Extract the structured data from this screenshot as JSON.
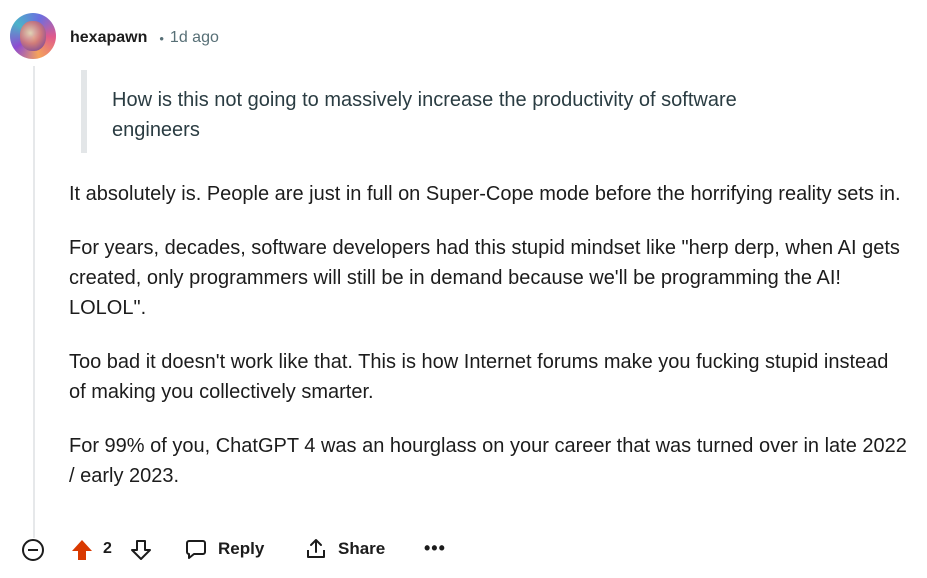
{
  "comment": {
    "username": "hexapawn",
    "separator": "•",
    "time_ago": "1d ago",
    "quote": "How is this not going to massively increase the productivity of software engineers",
    "paragraphs": [
      "It absolutely is. People are just in full on Super-Cope mode before the horrifying reality sets in.",
      "For years, decades, software developers had this stupid mindset like \"herp derp, when AI gets created, only programmers will still be in demand because we'll be programming the AI! LOLOL\".",
      "Too bad it doesn't work like that. This is how Internet forums make you fucking stupid instead of making you collectively smarter.",
      "For 99% of you, ChatGPT 4 was an hourglass on your career that was turned over in late 2022 / early 2023."
    ],
    "vote_count": "2",
    "reply_label": "Reply",
    "share_label": "Share",
    "more_label": "•••"
  },
  "colors": {
    "upvote_active": "#d93900",
    "meta_gray": "#576f76",
    "quote_bar": "#e3e6e8"
  }
}
